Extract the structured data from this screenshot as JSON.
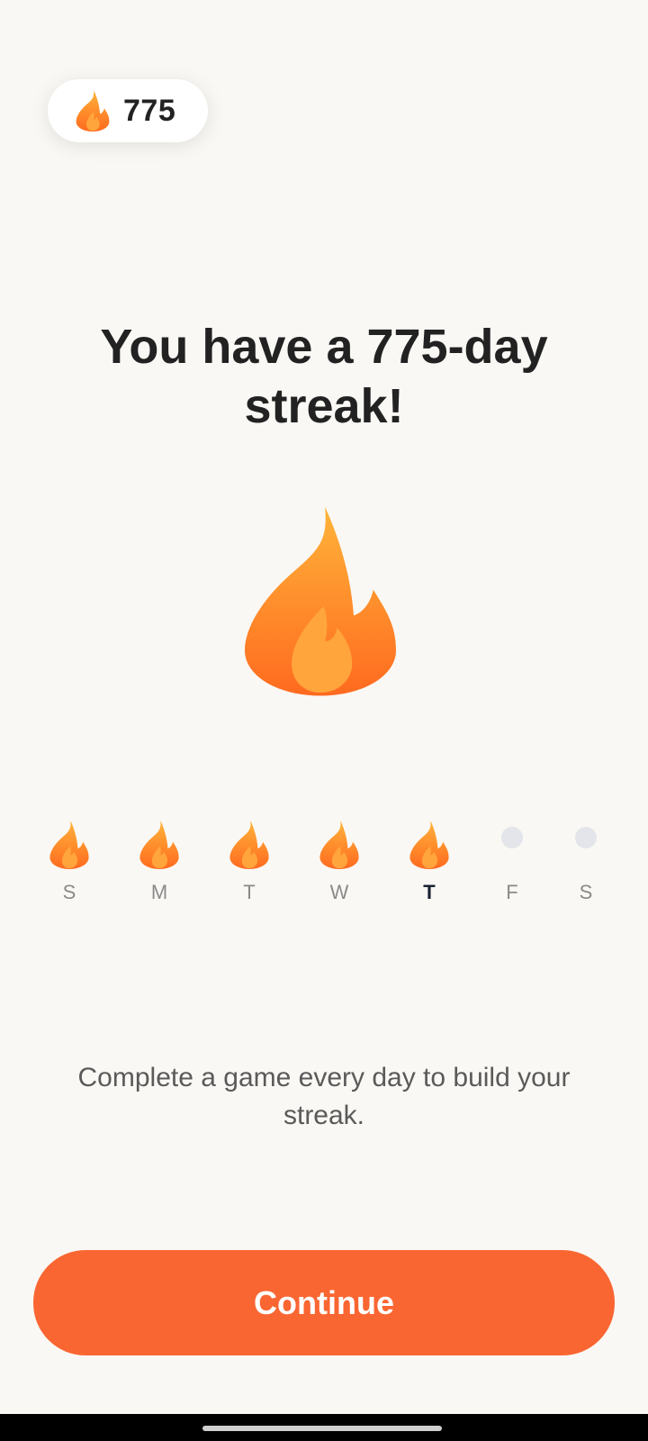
{
  "streak_badge": {
    "count": "775",
    "icon": "flame-icon"
  },
  "headline": {
    "line1": "You have a 775-day",
    "line2": "streak!"
  },
  "hero_icon": "flame-icon",
  "week": [
    {
      "label": "S",
      "completed": true,
      "today": false
    },
    {
      "label": "M",
      "completed": true,
      "today": false
    },
    {
      "label": "T",
      "completed": true,
      "today": false
    },
    {
      "label": "W",
      "completed": true,
      "today": false
    },
    {
      "label": "T",
      "completed": true,
      "today": true
    },
    {
      "label": "F",
      "completed": false,
      "today": false
    },
    {
      "label": "S",
      "completed": false,
      "today": false
    }
  ],
  "message": "Complete a game every day to build your streak.",
  "continue_label": "Continue",
  "colors": {
    "background": "#faf8f4",
    "accent": "#fa6632",
    "flame_top": "#ffb43a",
    "flame_bottom": "#ff6a1f",
    "inner_flame": "#ffa53c",
    "today_label": "#1a2233",
    "pending_dot": "#e3e5ea"
  }
}
